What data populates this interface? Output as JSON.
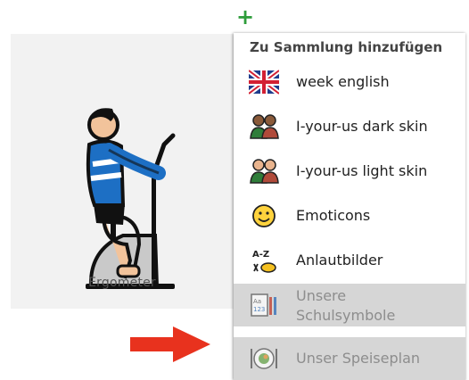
{
  "toolbar": {
    "add_label": "+"
  },
  "card": {
    "caption": "Ergometer"
  },
  "menu": {
    "header": "Zu Sammlung hinzufügen",
    "items": [
      {
        "label": "week english",
        "icon": "uk-flag-icon",
        "disabled": false
      },
      {
        "label": "I-your-us dark skin",
        "icon": "people-dark-skin-icon",
        "disabled": false
      },
      {
        "label": "I-your-us light skin",
        "icon": "people-light-skin-icon",
        "disabled": false
      },
      {
        "label": "Emoticons",
        "icon": "smiley-icon",
        "disabled": false
      },
      {
        "label": "Anlautbilder",
        "icon": "a-z-letters-icon",
        "disabled": false
      },
      {
        "label": "Unsere Schulsymbole",
        "line1": "Unsere",
        "line2": "Schulsymbole",
        "icon": "school-symbols-icon",
        "disabled": true
      },
      {
        "label": "Unser Speiseplan",
        "icon": "meal-plate-icon",
        "disabled": true
      }
    ]
  },
  "colors": {
    "plus": "#2e9d3b",
    "arrow": "#e8321e",
    "disabled_bg": "#d6d6d6"
  },
  "decorations": {
    "arrow_icon": "red-arrow-right-icon"
  }
}
